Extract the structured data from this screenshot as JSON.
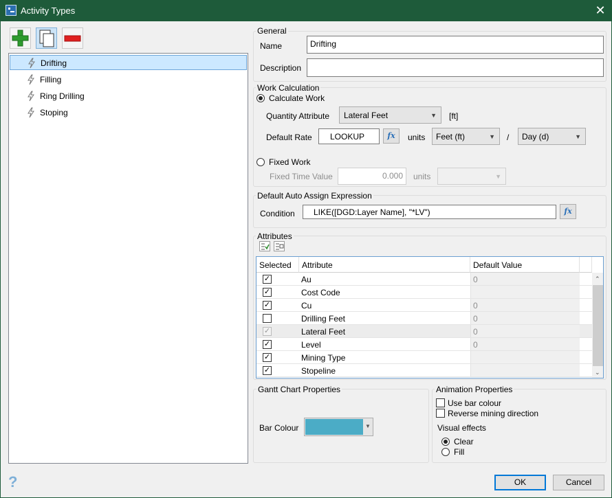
{
  "window": {
    "title": "Activity Types"
  },
  "toolbar": {
    "add_icon": "add-green-plus-icon",
    "copy_icon": "copy-pages-icon",
    "remove_icon": "remove-red-minus-icon"
  },
  "tree": {
    "items": [
      {
        "label": "Drifting",
        "selected": true
      },
      {
        "label": "Filling"
      },
      {
        "label": "Ring Drilling"
      },
      {
        "label": "Stoping"
      }
    ]
  },
  "general": {
    "title": "General",
    "name_label": "Name",
    "name_value": "Drifting",
    "description_label": "Description",
    "description_value": ""
  },
  "work": {
    "title": "Work Calculation",
    "calculate_label": "Calculate Work",
    "quantity_label": "Quantity Attribute",
    "quantity_value": "Lateral Feet",
    "quantity_unit": "[ft]",
    "rate_label": "Default Rate",
    "rate_value": "LOOKUP",
    "fx": "fx",
    "units_label": "units",
    "unit_num": "Feet (ft)",
    "slash": "/",
    "unit_den": "Day (d)",
    "fixed_label": "Fixed Work",
    "fixed_time_label": "Fixed Time Value",
    "fixed_time_value": "0.000",
    "fixed_units_label": "units"
  },
  "auto_assign": {
    "title": "Default Auto Assign Expression",
    "condition_label": "Condition",
    "condition_value": "LIKE([DGD:Layer Name], \"*LV\")"
  },
  "attributes": {
    "title": "Attributes",
    "columns": [
      "Selected",
      "Attribute",
      "Default Value"
    ],
    "rows": [
      {
        "checked": true,
        "name": "Au",
        "value": "0"
      },
      {
        "checked": true,
        "name": "Cost Code",
        "value": ""
      },
      {
        "checked": true,
        "name": "Cu",
        "value": "0"
      },
      {
        "checked": false,
        "name": "Drilling Feet",
        "value": "0"
      },
      {
        "checked": true,
        "disabled": true,
        "name": "Lateral Feet",
        "value": "0"
      },
      {
        "checked": true,
        "name": "Level",
        "value": "0"
      },
      {
        "checked": true,
        "name": "Mining Type",
        "value": ""
      },
      {
        "checked": true,
        "name": "Stopeline",
        "value": ""
      }
    ]
  },
  "gantt": {
    "title": "Gantt Chart Properties",
    "bar_colour_label": "Bar Colour",
    "bar_colour": "#4bacc6"
  },
  "animation": {
    "title": "Animation Properties",
    "use_bar_colour": "Use bar colour",
    "reverse": "Reverse mining direction",
    "visual_effects": "Visual effects",
    "clear": "Clear",
    "fill": "Fill"
  },
  "footer": {
    "ok": "OK",
    "cancel": "Cancel"
  }
}
